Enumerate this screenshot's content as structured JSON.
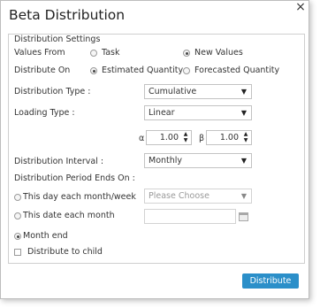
{
  "dialog": {
    "title": "Beta Distribution",
    "close_glyph": "×",
    "fieldset_legend": "Distribution Settings"
  },
  "values_from": {
    "label": "Values From",
    "options": [
      {
        "label": "Task",
        "checked": false
      },
      {
        "label": "New Values",
        "checked": true
      }
    ]
  },
  "distribute_on": {
    "label": "Distribute On",
    "options": [
      {
        "label": "Estimated Quantity",
        "checked": true
      },
      {
        "label": "Forecasted Quantity",
        "checked": false
      }
    ]
  },
  "distribution_type": {
    "label": "Distribution Type :",
    "value": "Cumulative"
  },
  "loading_type": {
    "label": "Loading Type :",
    "value": "Linear"
  },
  "alpha": {
    "symbol": "α",
    "value": "1.00"
  },
  "beta": {
    "symbol": "β",
    "value": "1.00"
  },
  "distribution_interval": {
    "label": "Distribution Interval :",
    "value": "Monthly"
  },
  "period_ends": {
    "label": "Distribution Period Ends On :",
    "this_day": {
      "label": "This day each month/week",
      "checked": false,
      "placeholder": "Please Choose"
    },
    "this_date": {
      "label": "This date each month",
      "checked": false
    },
    "month_end": {
      "label": "Month end",
      "checked": true
    }
  },
  "distribute_to_child": {
    "label": "Distribute to child",
    "checked": false
  },
  "actions": {
    "distribute_label": "Distribute"
  },
  "icons": {
    "dropdown": "caret-down-icon",
    "spinner": "spinner-arrows-icon",
    "calendar": "calendar-icon",
    "close": "close-icon"
  },
  "colors": {
    "primary_button": "#2b8fc9"
  }
}
